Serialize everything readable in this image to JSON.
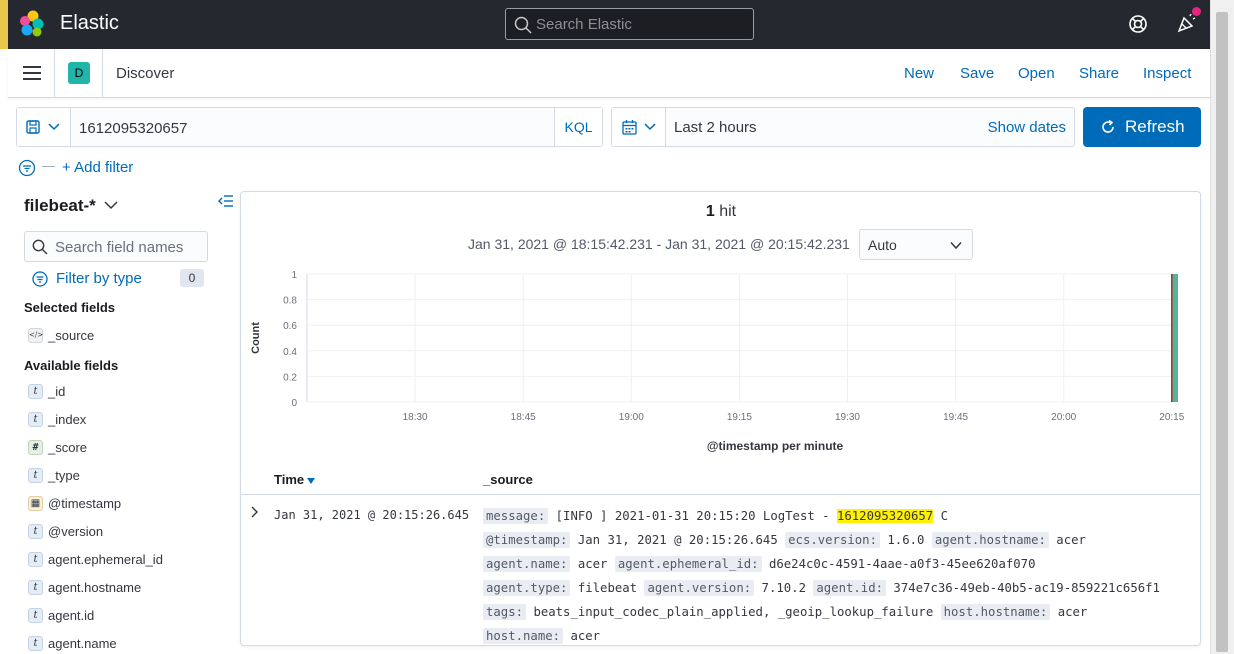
{
  "header": {
    "brand": "Elastic",
    "search_placeholder": "Search Elastic",
    "icons": [
      "elastic-logo-icon",
      "help-icon",
      "newsfeed-icon"
    ]
  },
  "appbar": {
    "space_initial": "D",
    "breadcrumb": "Discover",
    "menu": [
      "New",
      "Save",
      "Open",
      "Share",
      "Inspect"
    ]
  },
  "query": {
    "value": "1612095320657",
    "language": "KQL",
    "date_range": "Last 2 hours",
    "show_dates": "Show dates",
    "refresh": "Refresh",
    "add_filter": "+ Add filter",
    "filter_separator": "—"
  },
  "sidebar": {
    "index_pattern": "filebeat-*",
    "search_placeholder": "Search field names",
    "filter_by_type": "Filter by type",
    "filter_count": "0",
    "selected_title": "Selected fields",
    "selected": [
      {
        "type": "source",
        "token": "</>",
        "name": "_source"
      }
    ],
    "available_title": "Available fields",
    "available": [
      {
        "type": "string",
        "token": "t",
        "name": "_id"
      },
      {
        "type": "string",
        "token": "t",
        "name": "_index"
      },
      {
        "type": "number",
        "token": "#",
        "name": "_score"
      },
      {
        "type": "string",
        "token": "t",
        "name": "_type"
      },
      {
        "type": "date",
        "token": "▦",
        "name": "@timestamp"
      },
      {
        "type": "string",
        "token": "t",
        "name": "@version"
      },
      {
        "type": "string",
        "token": "t",
        "name": "agent.ephemeral_id"
      },
      {
        "type": "string",
        "token": "t",
        "name": "agent.hostname"
      },
      {
        "type": "string",
        "token": "t",
        "name": "agent.id"
      },
      {
        "type": "string",
        "token": "t",
        "name": "agent.name"
      }
    ]
  },
  "results": {
    "hit_count": "1",
    "hit_label": " hit",
    "time_range": "Jan 31, 2021 @ 18:15:42.231 - Jan 31, 2021 @ 20:15:42.231",
    "interval": "Auto",
    "columns": [
      "Time",
      "_source"
    ],
    "row": {
      "time": "Jan 31, 2021 @ 20:15:26.645",
      "source": [
        {
          "k": "message:",
          "v": "[INFO ] 2021-01-31 20:15:20 LogTest - ",
          "hl": "1612095320657",
          "after": " C"
        },
        {
          "k": "@timestamp:",
          "v": "Jan 31, 2021 @ 20:15:26.645"
        },
        {
          "k": "ecs.version:",
          "v": "1.6.0"
        },
        {
          "k": "agent.hostname:",
          "v": "acer"
        },
        {
          "k": "agent.name:",
          "v": "acer"
        },
        {
          "k": "agent.ephemeral_id:",
          "v": "d6e24c0c-4591-4aae-a0f3-45ee620af070"
        },
        {
          "k": "agent.type:",
          "v": "filebeat"
        },
        {
          "k": "agent.version:",
          "v": "7.10.2"
        },
        {
          "k": "agent.id:",
          "v": "374e7c36-49eb-40b5-ac19-859221c656f1"
        },
        {
          "k": "tags:",
          "v": "beats_input_codec_plain_applied, _geoip_lookup_failure"
        },
        {
          "k": "host.hostname:",
          "v": "acer"
        },
        {
          "k": "host.name:",
          "v": "acer"
        }
      ]
    }
  },
  "chart_data": {
    "type": "bar",
    "ylabel": "Count",
    "xlabel": "@timestamp per minute",
    "ylim": [
      0,
      1
    ],
    "yticks": [
      "0",
      "0.2",
      "0.4",
      "0.6",
      "0.8",
      "1"
    ],
    "xticks": [
      "18:30",
      "18:45",
      "19:00",
      "19:15",
      "19:30",
      "19:45",
      "20:00",
      "20:15"
    ],
    "x_start": "18:15",
    "x_end": "20:16",
    "bars": [
      {
        "x": "20:15",
        "value": 1
      }
    ],
    "bar_color": "#54b399",
    "now_marker_color": "#bd271e",
    "grid": true
  },
  "colors": {
    "header_bg": "#25282f",
    "accent": "#006bb8",
    "space_badge": "#20b5a8",
    "highlight": "#fff200"
  }
}
